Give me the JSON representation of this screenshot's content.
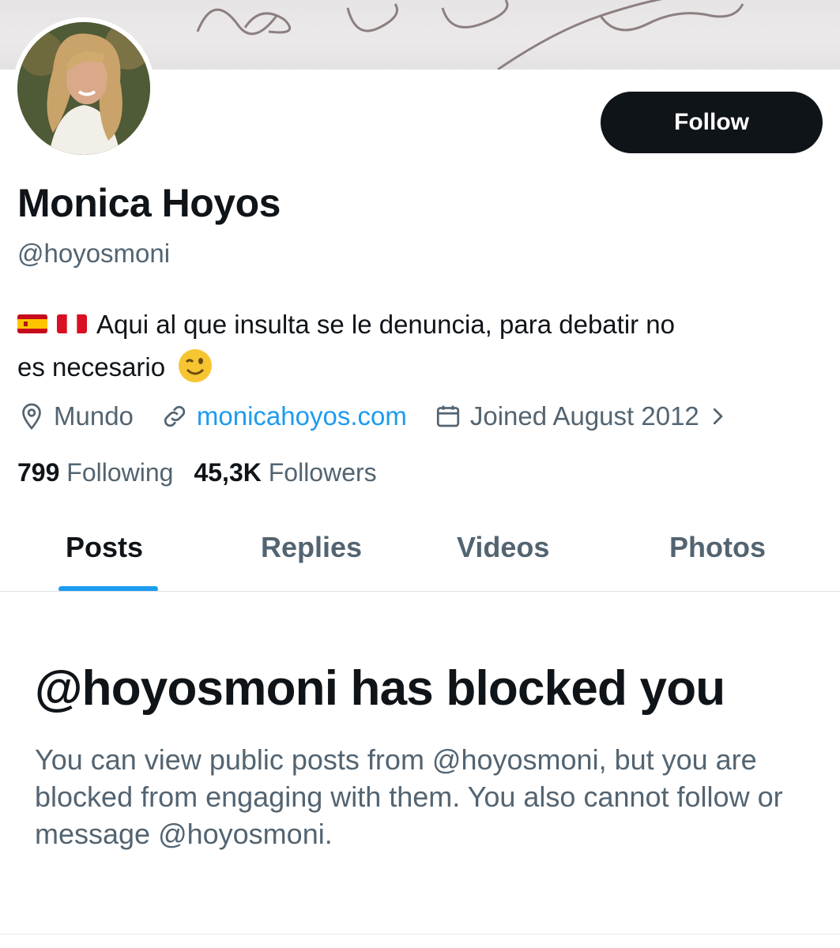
{
  "profile": {
    "display_name": "Monica Hoyos",
    "handle": "@hoyosmoni",
    "bio_line1": "Aqui al que insulta se le denuncia, para debatir no",
    "bio_line2": "es necesario",
    "bio_flags": [
      "spain-flag-emoji",
      "peru-flag-emoji"
    ],
    "bio_emoji": "winking-face-emoji",
    "location": "Mundo",
    "website": "monicahoyos.com",
    "joined": "Joined August 2012",
    "following_count": "799",
    "following_label": "Following",
    "followers_count": "45,3K",
    "followers_label": "Followers"
  },
  "actions": {
    "follow_label": "Follow"
  },
  "tabs": [
    {
      "label": "Posts",
      "active": true
    },
    {
      "label": "Replies",
      "active": false
    },
    {
      "label": "Videos",
      "active": false
    },
    {
      "label": "Photos",
      "active": false
    }
  ],
  "blocked": {
    "title": "@hoyosmoni has blocked you",
    "message": "You can view public posts from @hoyosmoni, but you are blocked from engaging with them. You also cannot follow or message @hoyosmoni."
  },
  "icons": {
    "location": "location-pin-icon",
    "website": "link-icon",
    "joined": "calendar-icon",
    "joined_more": "chevron-right-icon"
  },
  "colors": {
    "text_primary": "#0f1419",
    "text_secondary": "#536471",
    "accent": "#1d9bf0",
    "button_bg": "#0f1419",
    "button_text": "#ffffff"
  }
}
